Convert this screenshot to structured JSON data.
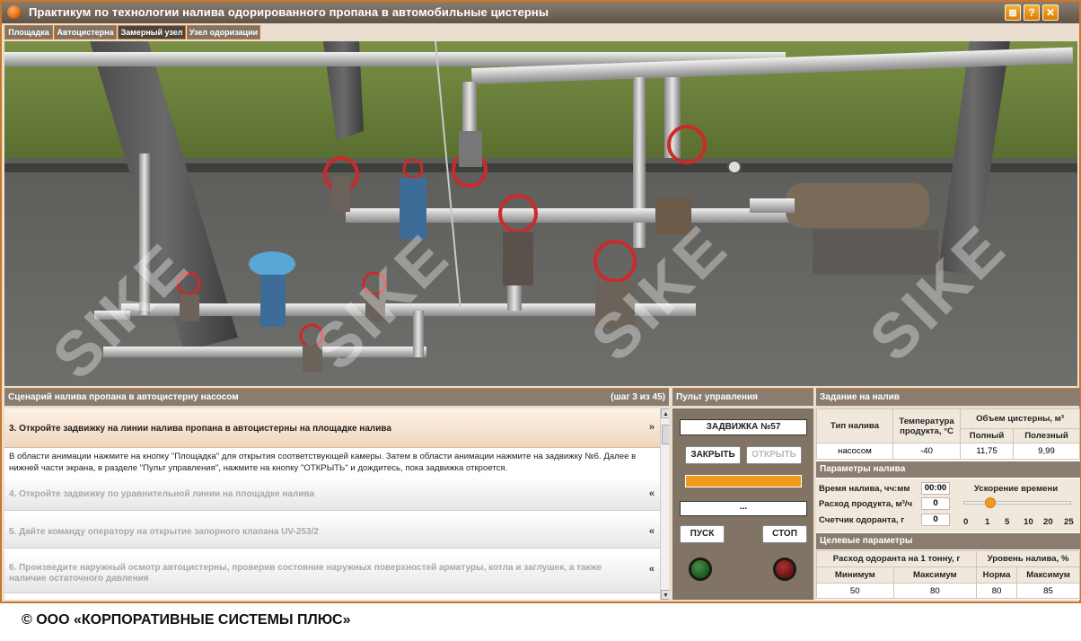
{
  "app": {
    "title": "Практикум по технологии налива одорированного пропана в автомобильные цистерны",
    "window_buttons": [
      {
        "icon": "notepad-icon",
        "glyph": "≣"
      },
      {
        "icon": "help-icon",
        "glyph": "?"
      },
      {
        "icon": "close-icon",
        "glyph": "✕"
      }
    ]
  },
  "tabs": [
    {
      "label": "Площадка"
    },
    {
      "label": "Автоцистерна"
    },
    {
      "label": "Замерный узел",
      "active": true
    },
    {
      "label": "Узел одоризации"
    }
  ],
  "watermark": "SIKE",
  "scenario": {
    "title": "Сценарий налива пропана в автоцистерну насосом",
    "step_counter": "(шаг 3 из 45)",
    "current_step": "3.  Откройте задвижку на линии налива пропана в автоцистерны на площадке налива",
    "current_description": "В области анимации нажмите на кнопку \"Площадка\" для открытия соответствующей камеры. Затем в области анимации нажмите на задвижку №6. Далее в нижней части экрана, в разделе \"Пульт управления\", нажмите на кнопку \"ОТКРЫТЬ\" и дождитесь, пока задвижка откроется.",
    "other_steps": [
      "4.  Откройте задвижку по уравнительной линии на площадке налива",
      "5.  Дайте команду оператору на открытие запорного клапана UV-253/2",
      "6.  Произведите наружный осмотр автоцистерны, проверив состояние наружных поверхностей арматуры, котла и заглушек, а также наличие остаточного давления"
    ],
    "chevron_current": "»",
    "chevron_other": "«"
  },
  "control_panel": {
    "title": "Пульт управления",
    "device_label": "ЗАДВИЖКА №57",
    "close_button": "ЗАКРЫТЬ",
    "open_button": "ОТКРЫТЬ",
    "progress": 1.0,
    "status": "...",
    "start_button": "ПУСК",
    "stop_button": "СТОП",
    "start_lamp_color": "#1d5a1d",
    "stop_lamp_color": "#6b1212"
  },
  "task": {
    "title": "Задание на налив",
    "col_type": "Тип налива",
    "col_temp": "Температура продукта, °С",
    "col_volume": "Объем цистерны, м³",
    "col_full": "Полный",
    "col_useful": "Полезный",
    "type": "насосом",
    "temp": "-40",
    "full": "11,75",
    "useful": "9,99"
  },
  "params": {
    "title": "Параметры налива",
    "time_label": "Время налива, чч:мм",
    "time_value": "00:00",
    "flow_label": "Расход продукта, м³/ч",
    "flow_value": "0",
    "counter_label": "Счетчик одоранта, г",
    "counter_value": "0",
    "speed_title": "Ускорение времени",
    "speed_ticks": [
      "0",
      "1",
      "5",
      "10",
      "20",
      "25"
    ],
    "speed_value": "1"
  },
  "target": {
    "title": "Целевые параметры",
    "odorant_title": "Расход одоранта на 1 тонну, г",
    "level_title": "Уровень налива, %",
    "col_min": "Минимум",
    "col_max": "Максимум",
    "col_norm": "Норма",
    "col_max2": "Максимум",
    "odor_min": "50",
    "odor_max": "80",
    "level_norm": "80",
    "level_max": "85"
  },
  "colors": {
    "accent": "#c9772a",
    "header": "#8a7d6f",
    "progress": "#f19a1c"
  },
  "copyright": "© ООО «КОРПОРАТИВНЫЕ СИСТЕМЫ ПЛЮС»"
}
